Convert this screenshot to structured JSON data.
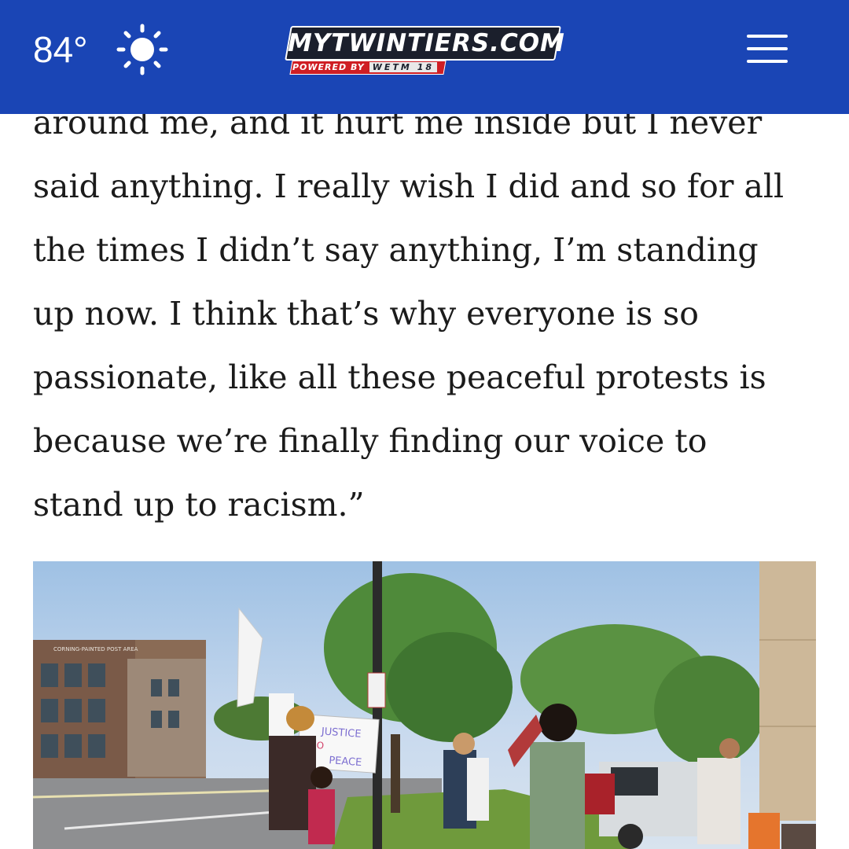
{
  "header": {
    "temperature": "84°",
    "weather_icon": "sun-icon",
    "logo": {
      "title": "MYTWINTIERS.COM",
      "powered_by": "POWERED BY",
      "station": "WETM 18"
    },
    "menu_icon": "hamburger-menu-icon",
    "colors": {
      "bar": "#1a45b5",
      "logo_red": "#cf1e24"
    }
  },
  "article": {
    "lines": [
      "around me, and it hurt me inside but I never",
      "said anything. I really wish I did and so for all",
      "the times I didn’t say anything, I’m standing",
      "up now. I think that’s why everyone is so",
      "passionate, like all these peaceful protests is",
      "because we’re finally finding our voice to",
      "stand up to racism.”"
    ]
  },
  "photo": {
    "sign_text": [
      "JUSTICE",
      "NO",
      "PEACE"
    ],
    "building_sign": "CORNING-PAINTED POST AREA"
  }
}
